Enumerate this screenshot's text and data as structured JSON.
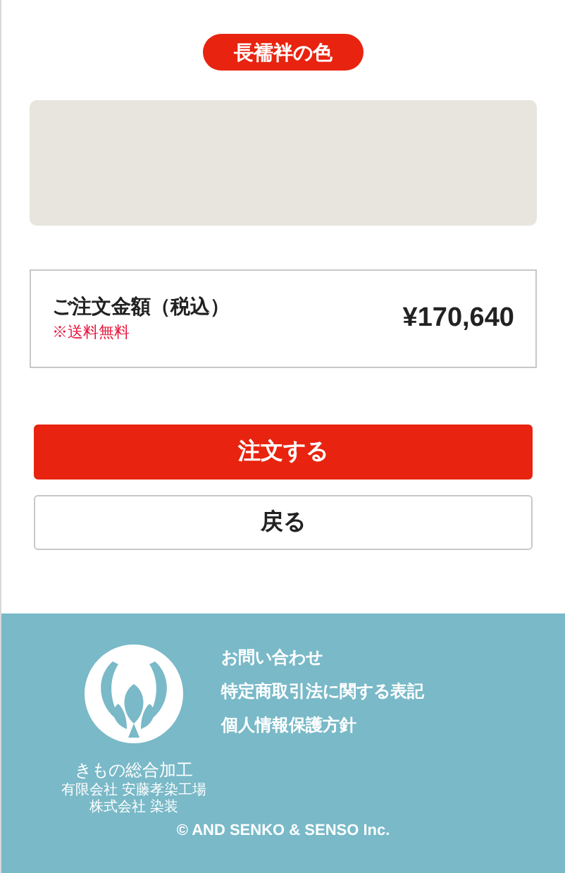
{
  "section_badge": "長襦袢の色",
  "color_swatch": {
    "color": "#e8e5de"
  },
  "order_summary": {
    "label": "ご注文金額（税込）",
    "note": "※送料無料",
    "amount": "¥170,640"
  },
  "buttons": [
    {
      "label": "注文する",
      "kind": "primary"
    },
    {
      "label": "戻る",
      "kind": "secondary"
    }
  ],
  "footer": {
    "logo": {
      "title": "きもの総合加工",
      "companies": [
        {
          "type": "有限会社",
          "name": "安藤孝染工場"
        },
        {
          "type": "株式会社",
          "name": "染装"
        }
      ]
    },
    "links": [
      "お問い合わせ",
      "特定商取引法に関する表記",
      "個人情報保護方針"
    ],
    "copyright": "© AND SENKO & SENSO Inc."
  }
}
